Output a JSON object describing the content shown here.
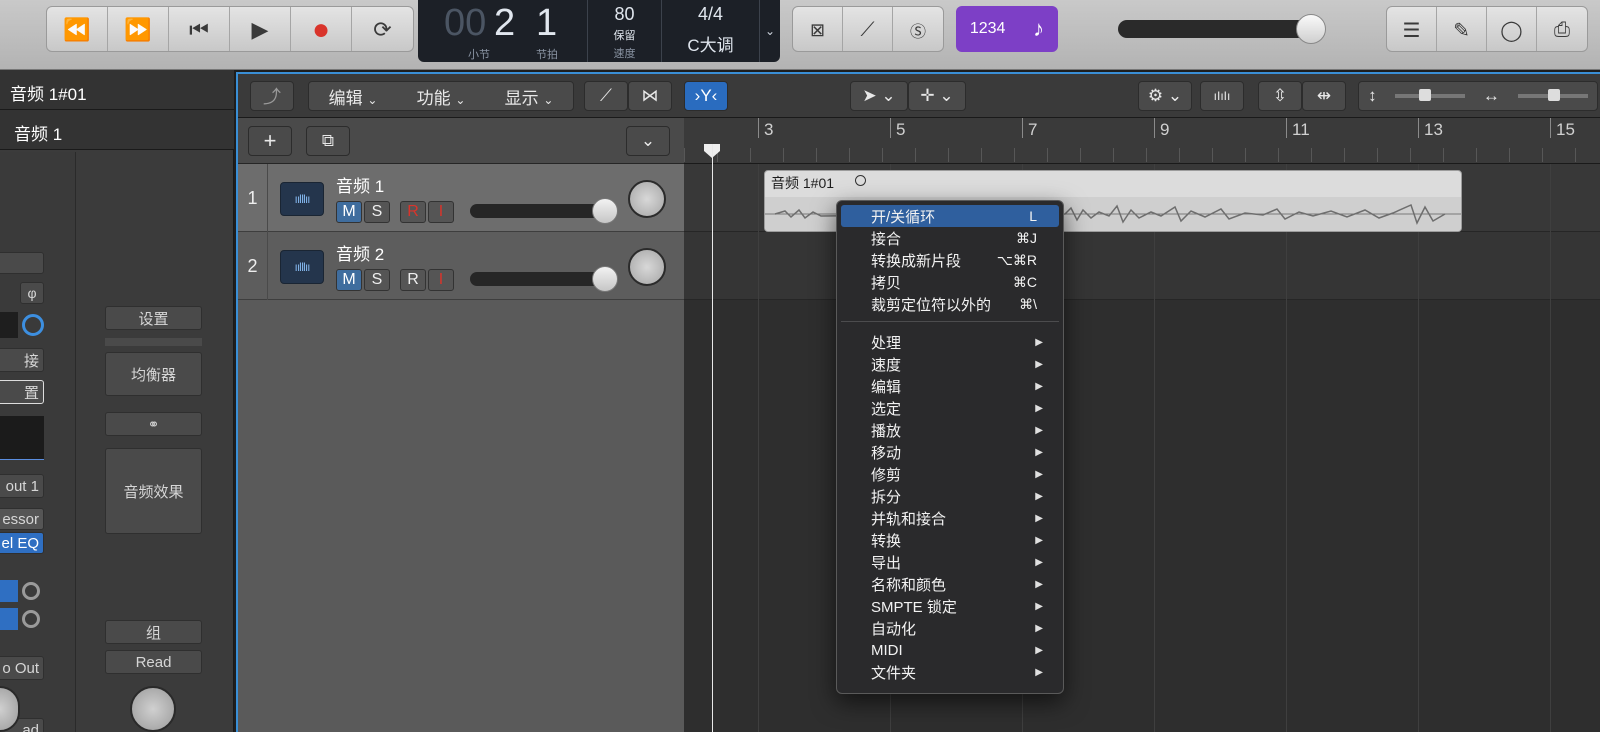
{
  "transport": {
    "rewind": "⏪",
    "forward": "⏩",
    "to_start": "⏮",
    "play": "▶",
    "record": "●",
    "cycle": "⟳"
  },
  "lcd": {
    "bar_dim": "00",
    "bar": "2",
    "beat": "1",
    "bar_label": "小节",
    "beat_label": "节拍",
    "tempo": "80",
    "tempo_mode": "保留",
    "tempo_label": "速度",
    "signature": "4/4",
    "key": "C大调"
  },
  "modes": {
    "count_in": "1234"
  },
  "inspector": {
    "region_title": "音频 1#01",
    "track_title": "音频 1",
    "left_strip": {
      "phase": "φ",
      "connect": "接",
      "settings": "置",
      "output": "out 1",
      "plugin1": "essor",
      "plugin2": "el EQ",
      "bus": "o Out",
      "automation": "ad"
    },
    "right_strip": {
      "settings": "设置",
      "eq": "均衡器",
      "effects": "音频效果",
      "group": "组",
      "automation": "Read"
    }
  },
  "localbar": {
    "edit": "编辑",
    "functions": "功能",
    "view": "显示"
  },
  "tracks": [
    {
      "num": "1",
      "name": "音频 1",
      "mute": "M",
      "solo": "S",
      "rec": "R",
      "input": "I"
    },
    {
      "num": "2",
      "name": "音频 2",
      "mute": "M",
      "solo": "S",
      "rec": "R",
      "input": "I"
    }
  ],
  "ruler": {
    "bars": [
      "3",
      "5",
      "7",
      "9",
      "11",
      "13",
      "15"
    ]
  },
  "region": {
    "title": "音频 1#01"
  },
  "context_menu": {
    "items": [
      {
        "label": "开/关循环",
        "shortcut": "L"
      },
      {
        "label": "接合",
        "shortcut": "⌘J"
      },
      {
        "label": "转换成新片段",
        "shortcut": "⌥⌘R"
      },
      {
        "label": "拷贝",
        "shortcut": "⌘C"
      },
      {
        "label": "裁剪定位符以外的",
        "shortcut": "⌘\\"
      }
    ],
    "submenus": [
      "处理",
      "速度",
      "编辑",
      "选定",
      "播放",
      "移动",
      "修剪",
      "拆分",
      "并轨和接合",
      "转换",
      "导出",
      "名称和颜色",
      "SMPTE 锁定",
      "自动化",
      "MIDI",
      "文件夹"
    ],
    "submenu_arrow": "▶"
  },
  "colors": {
    "accent_blue": "#3a8fd6",
    "highlight": "#2f5f9e",
    "purple": "#7d3fc6",
    "record_red": "#d9342b"
  }
}
